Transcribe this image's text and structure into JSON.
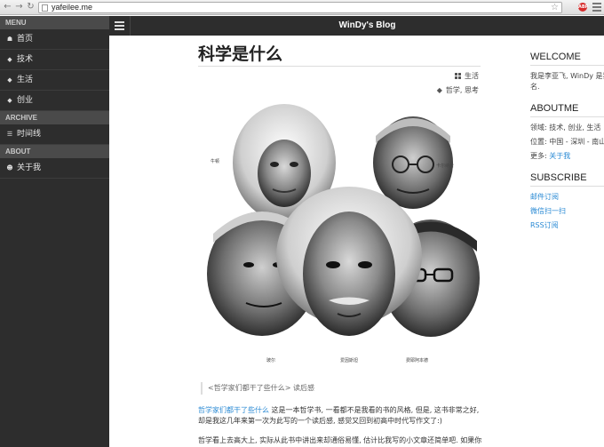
{
  "browser": {
    "back_icon": "arrow-left-icon",
    "forward_icon": "arrow-right-icon",
    "reload_icon": "reload-icon",
    "url": "yafeilee.me",
    "abp_label": "ABP"
  },
  "sidebar": {
    "menu_header": "MENU",
    "menu_items": [
      {
        "label": "首页",
        "icon": "home-icon"
      },
      {
        "label": "技术",
        "icon": "tag-icon"
      },
      {
        "label": "生活",
        "icon": "tag-icon"
      },
      {
        "label": "创业",
        "icon": "tag-icon"
      }
    ],
    "archive_header": "ARCHIVE",
    "archive_items": [
      {
        "label": "时间线",
        "icon": "list-icon"
      }
    ],
    "about_header": "ABOUT",
    "about_items": [
      {
        "label": "关于我",
        "icon": "user-icon"
      }
    ]
  },
  "topbar": {
    "blog_title": "WinDy's Blog"
  },
  "post": {
    "title": "科学是什么",
    "category": "生活",
    "tags": "哲学, 思考",
    "image_labels": [
      "牛顿",
      "卡尔纳普",
      "玻尔",
      "爱因斯坦",
      "费耶阿本德"
    ],
    "quote": "<哲学家们都干了些什么> 读后感",
    "para1_link": "哲学家们都干了些什么",
    "para1_text": " 这是一本哲学书, 一看都不是我看的书的风格, 但是, 这书非常之好, 却是我这几年来第一次为此写的一个读后感, 感觉又回到初高中时代写作文了:)",
    "para2_text": "哲学看上去高大上, 实际从此书中讲出来却通俗易懂, 估计比我写的小文章还简单吧. 如果你"
  },
  "right": {
    "welcome_title": "WELCOME",
    "welcome_text": "我是李亚飞, WinDy 是我",
    "welcome_text2": "名.",
    "aboutme_title": "ABOUTME",
    "field": "领域: 技术, 创业, 生活",
    "location": "位置: 中国 - 深圳 - 南山",
    "more_label": "更多: ",
    "more_link": "关于我",
    "subscribe_title": "SUBSCRIBE",
    "subscribe_links": [
      "邮件订阅",
      "微信扫一扫",
      "RSS订阅"
    ]
  }
}
